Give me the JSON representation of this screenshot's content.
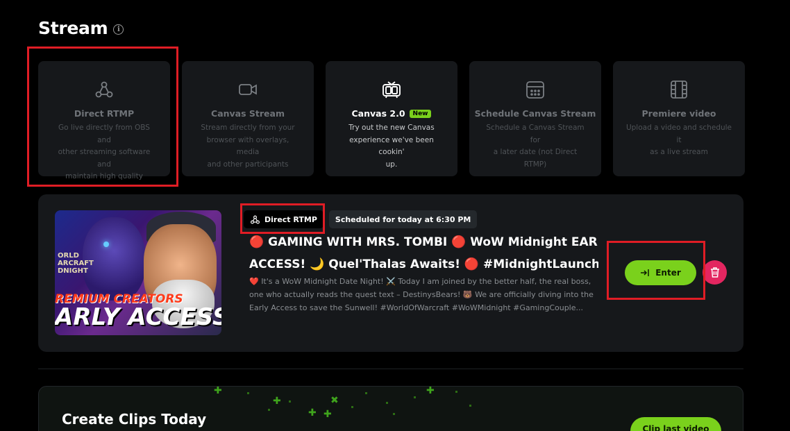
{
  "page": {
    "title": "Stream",
    "info_icon": "info-icon"
  },
  "cards": [
    {
      "title": "Direct RTMP",
      "desc_lines": [
        "Go live directly from OBS and",
        "other streaming software and",
        "maintain high quality"
      ],
      "icon": "rtmp-icon"
    },
    {
      "title": "Canvas Stream",
      "desc_lines": [
        "Stream directly from your",
        "browser with overlays, media",
        "and other participants"
      ],
      "icon": "video-camera-icon"
    },
    {
      "title": "Canvas 2.0",
      "badge": "New",
      "desc_lines": [
        "Try out the new Canvas",
        "experience we've been cookin'",
        "up."
      ],
      "icon": "tv-icon"
    },
    {
      "title": "Schedule Canvas Stream",
      "desc_lines": [
        "Schedule a Canvas Stream for",
        "a later date (not Direct RTMP)"
      ],
      "icon": "calendar-icon"
    },
    {
      "title": "Premiere video",
      "desc_lines": [
        "Upload a video and schedule it",
        "as a live stream"
      ],
      "icon": "film-icon"
    }
  ],
  "event": {
    "type_tag": "Direct RTMP",
    "schedule_tag": "Scheduled for today at 6:30 PM",
    "title_line1": "🔴 GAMING WITH MRS. TOMBI 🔴 WoW Midnight EARL",
    "title_line2": "ACCESS! 🌙 Quel'Thalas Awaits! 🔴 #MidnightLaunch",
    "desc_lines": [
      "❤️ It's a WoW Midnight Date Night! ⚔️ Today I am joined by the better half, the real boss,",
      "one who actually reads the quest text – DestinysBears! 🐻 We are officially diving into the",
      "Early Access to save the Sunwell! #WorldOfWarcraft #WoWMidnight #GamingCouple..."
    ],
    "thumbnail": {
      "wow_text": "ORLD\nARCRAFT\nDNIGHT",
      "banner_line1": "REMIUM CREATORS",
      "banner_line2": "ARLY ACCESS"
    },
    "enter_label": "Enter",
    "enter_icon": "enter-arrow-icon",
    "delete_icon": "trash-icon"
  },
  "clips": {
    "title": "Create Clips Today",
    "button_label": "Clip last video"
  },
  "colors": {
    "accent": "#7ad11c",
    "danger": "#e32660",
    "highlight": "#e01d25",
    "card_bg": "#16181b"
  }
}
